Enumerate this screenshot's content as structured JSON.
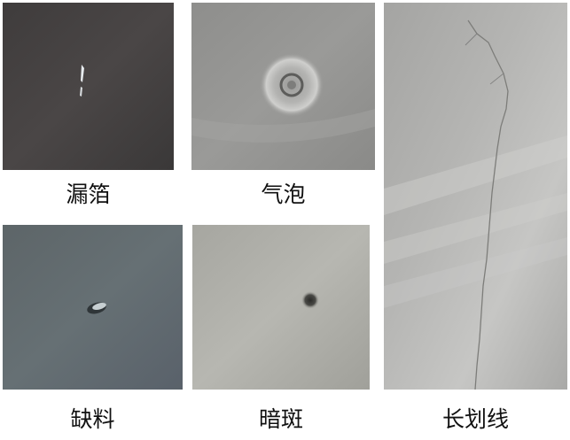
{
  "panels": [
    {
      "label": "漏箔"
    },
    {
      "label": "气泡"
    },
    {
      "label": "长划线"
    },
    {
      "label": "缺料"
    },
    {
      "label": "暗斑"
    }
  ]
}
